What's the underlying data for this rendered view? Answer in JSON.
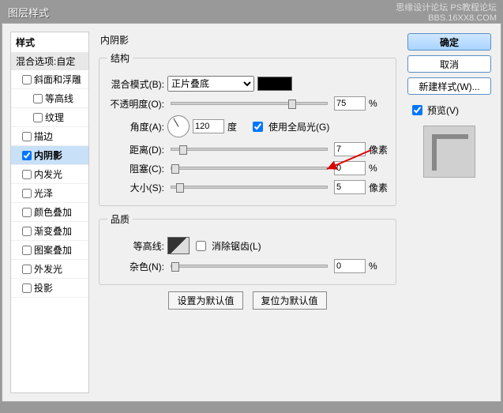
{
  "watermark": {
    "line1": "思缘设计论坛  PS教程论坛",
    "line2": "BBS.16XX8.COM"
  },
  "title": "图层样式",
  "left": {
    "header": "样式",
    "blend": "混合选项:自定",
    "items": [
      {
        "label": "斜面和浮雕",
        "checked": false,
        "indent": false
      },
      {
        "label": "等高线",
        "checked": false,
        "indent": true
      },
      {
        "label": "纹理",
        "checked": false,
        "indent": true
      },
      {
        "label": "描边",
        "checked": false,
        "indent": false
      },
      {
        "label": "内阴影",
        "checked": true,
        "indent": false,
        "selected": true
      },
      {
        "label": "内发光",
        "checked": false,
        "indent": false
      },
      {
        "label": "光泽",
        "checked": false,
        "indent": false
      },
      {
        "label": "颜色叠加",
        "checked": false,
        "indent": false
      },
      {
        "label": "渐变叠加",
        "checked": false,
        "indent": false
      },
      {
        "label": "图案叠加",
        "checked": false,
        "indent": false
      },
      {
        "label": "外发光",
        "checked": false,
        "indent": false
      },
      {
        "label": "投影",
        "checked": false,
        "indent": false
      }
    ]
  },
  "mid": {
    "section_title": "内阴影",
    "structure_legend": "结构",
    "quality_legend": "品质",
    "blend_mode_label": "混合模式(B):",
    "blend_mode_value": "正片叠底",
    "opacity_label": "不透明度(O):",
    "opacity_value": "75",
    "opacity_unit": "%",
    "angle_label": "角度(A):",
    "angle_value": "120",
    "angle_unit": "度",
    "global_light_label": "使用全局光(G)",
    "distance_label": "距离(D):",
    "distance_value": "7",
    "distance_unit": "像素",
    "choke_label": "阻塞(C):",
    "choke_value": "0",
    "choke_unit": "%",
    "size_label": "大小(S):",
    "size_value": "5",
    "size_unit": "像素",
    "contour_label": "等高线:",
    "antialias_label": "消除锯齿(L)",
    "noise_label": "杂色(N):",
    "noise_value": "0",
    "noise_unit": "%",
    "btn_default": "设置为默认值",
    "btn_reset": "复位为默认值"
  },
  "right": {
    "ok": "确定",
    "cancel": "取消",
    "new_style": "新建样式(W)...",
    "preview": "预览(V)"
  }
}
